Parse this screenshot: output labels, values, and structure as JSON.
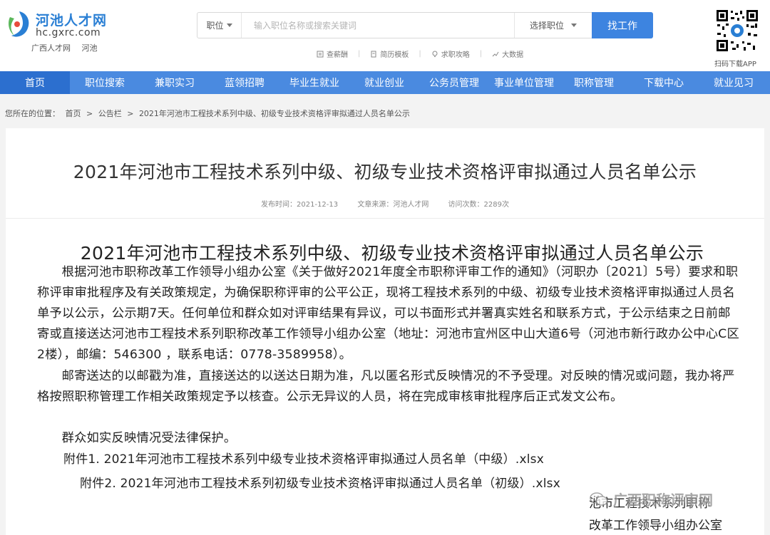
{
  "logo": {
    "name": "河池人才网",
    "domain": "hc.gxrc.com",
    "sub_left": "广西人才网",
    "sub_right": "河池"
  },
  "search": {
    "category": "职位",
    "placeholder": "输入职位名称或搜索关键词",
    "position_select": "选择职位",
    "button": "找工作"
  },
  "quick_links": [
    {
      "label": "查薪酬",
      "icon": "salary-icon"
    },
    {
      "label": "简历模板",
      "icon": "document-icon"
    },
    {
      "label": "求职攻略",
      "icon": "bulb-icon"
    },
    {
      "label": "大数据",
      "icon": "chart-icon"
    }
  ],
  "qr": {
    "label": "扫码下载APP"
  },
  "nav": [
    "首页",
    "职位搜索",
    "兼职实习",
    "蓝领招聘",
    "毕业生就业",
    "就业创业",
    "公务员管理",
    "事业单位管理",
    "职称管理",
    "下载中心",
    "就业见习"
  ],
  "breadcrumb": {
    "prefix": "您所在的位置：",
    "items": [
      "首页",
      "公告栏",
      "2021年河池市工程技术系列中级、初级专业技术资格评审拟通过人员名单公示"
    ],
    "separator": ">"
  },
  "article": {
    "title": "2021年河池市工程技术系列中级、初级专业技术资格评审拟通过人员名单公示",
    "publish_time": "发布时间：2021-12-13",
    "source": "文章来源：河池人才网",
    "visits": "访问次数：2289次",
    "body_title": "2021年河池市工程技术系列中级、初级专业技术资格评审拟通过人员名单公示",
    "para1": "根据河池市职称改革工作领导小组办公室《关于做好2021年度全市职称评审工作的通知》（河职办〔2021〕5号）要求和职称评审审批程序及有关政策规定，为确保职称评审的公平公正，现将工程技术系列的中级、初级专业技术资格评审拟通过人员名单予以公示，公示期7天。任何单位和群众如对评审结果有异议，可以书面形式并署真实姓名和联系方式，于公示结束之日前邮寄或直接送达河池市工程技术系列职称改革工作领导小组办公室（地址：河池市宜州区中山大道6号（河池市新行政办公中心C区2楼），邮编：546300 ，联系电话：0778-3589958）。",
    "para2": "邮寄送达的以邮戳为准，直接送达的以送达日期为准，凡以匿名形式反映情况的不予受理。对反映的情况或问题，我办将严格按照职称管理工作相关政策规定予以核查。公示无异议的人员，将在完成审核审批程序后正式发文公布。",
    "para3": "群众如实反映情况受法律保护。",
    "attachment1": "附件1. 2021年河池市工程技术系列中级专业技术资格评审拟通过人员名单（中级）.xlsx",
    "attachment2": "附件2. 2021年河池市工程技术系列初级专业技术资格评审拟通过人员名单（初级）.xlsx",
    "sign1": "池市工程技术系列职称",
    "sign2": "改革工作领导小组办公室"
  },
  "watermark": {
    "text": "广西职称评审网"
  },
  "colors": {
    "nav": "#4a8ae0",
    "nav_active": "#2c6fcf",
    "button": "#3d84e0",
    "brand": "#2a7fd4"
  }
}
